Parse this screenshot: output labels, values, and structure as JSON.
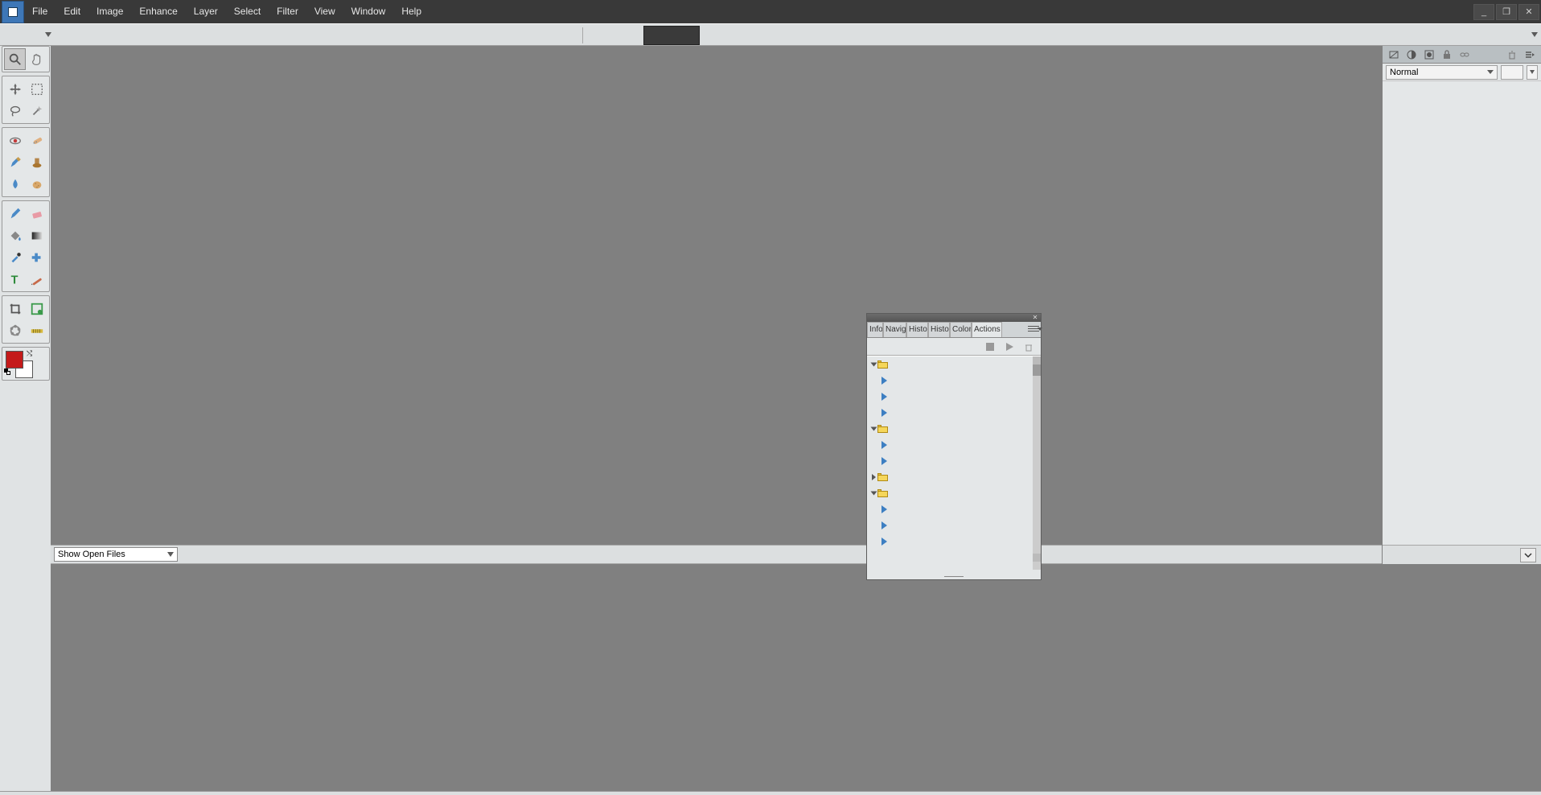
{
  "menubar": {
    "items": [
      "File",
      "Edit",
      "Image",
      "Enhance",
      "Layer",
      "Select",
      "Filter",
      "View",
      "Window",
      "Help"
    ]
  },
  "window_controls": {
    "min": "_",
    "max": "❐",
    "close": "✕"
  },
  "layers_panel": {
    "blend_mode": "Normal",
    "mini_tools": [
      "new-layer-icon",
      "new-adjustment-icon",
      "new-mask-icon",
      "lock-icon",
      "link-icon"
    ],
    "right_tools": [
      "trash-icon",
      "menu-icon"
    ]
  },
  "project_bar": {
    "select_label": "Show Open Files"
  },
  "actions_panel": {
    "tabs": [
      "Info",
      "Navig",
      "Histo",
      "Histo",
      "Color",
      "Actions"
    ],
    "active_tab": 5,
    "toolbar": [
      "stop-icon",
      "play-icon",
      "trash-icon"
    ],
    "tree": [
      {
        "type": "folder",
        "open": true
      },
      {
        "type": "action"
      },
      {
        "type": "action"
      },
      {
        "type": "action"
      },
      {
        "type": "folder",
        "open": true
      },
      {
        "type": "action"
      },
      {
        "type": "action"
      },
      {
        "type": "folder",
        "open": false
      },
      {
        "type": "folder",
        "open": true
      },
      {
        "type": "action"
      },
      {
        "type": "action"
      },
      {
        "type": "action"
      }
    ]
  },
  "toolbox_colors": {
    "foreground": "#c41a1a",
    "background": "#ffffff"
  }
}
